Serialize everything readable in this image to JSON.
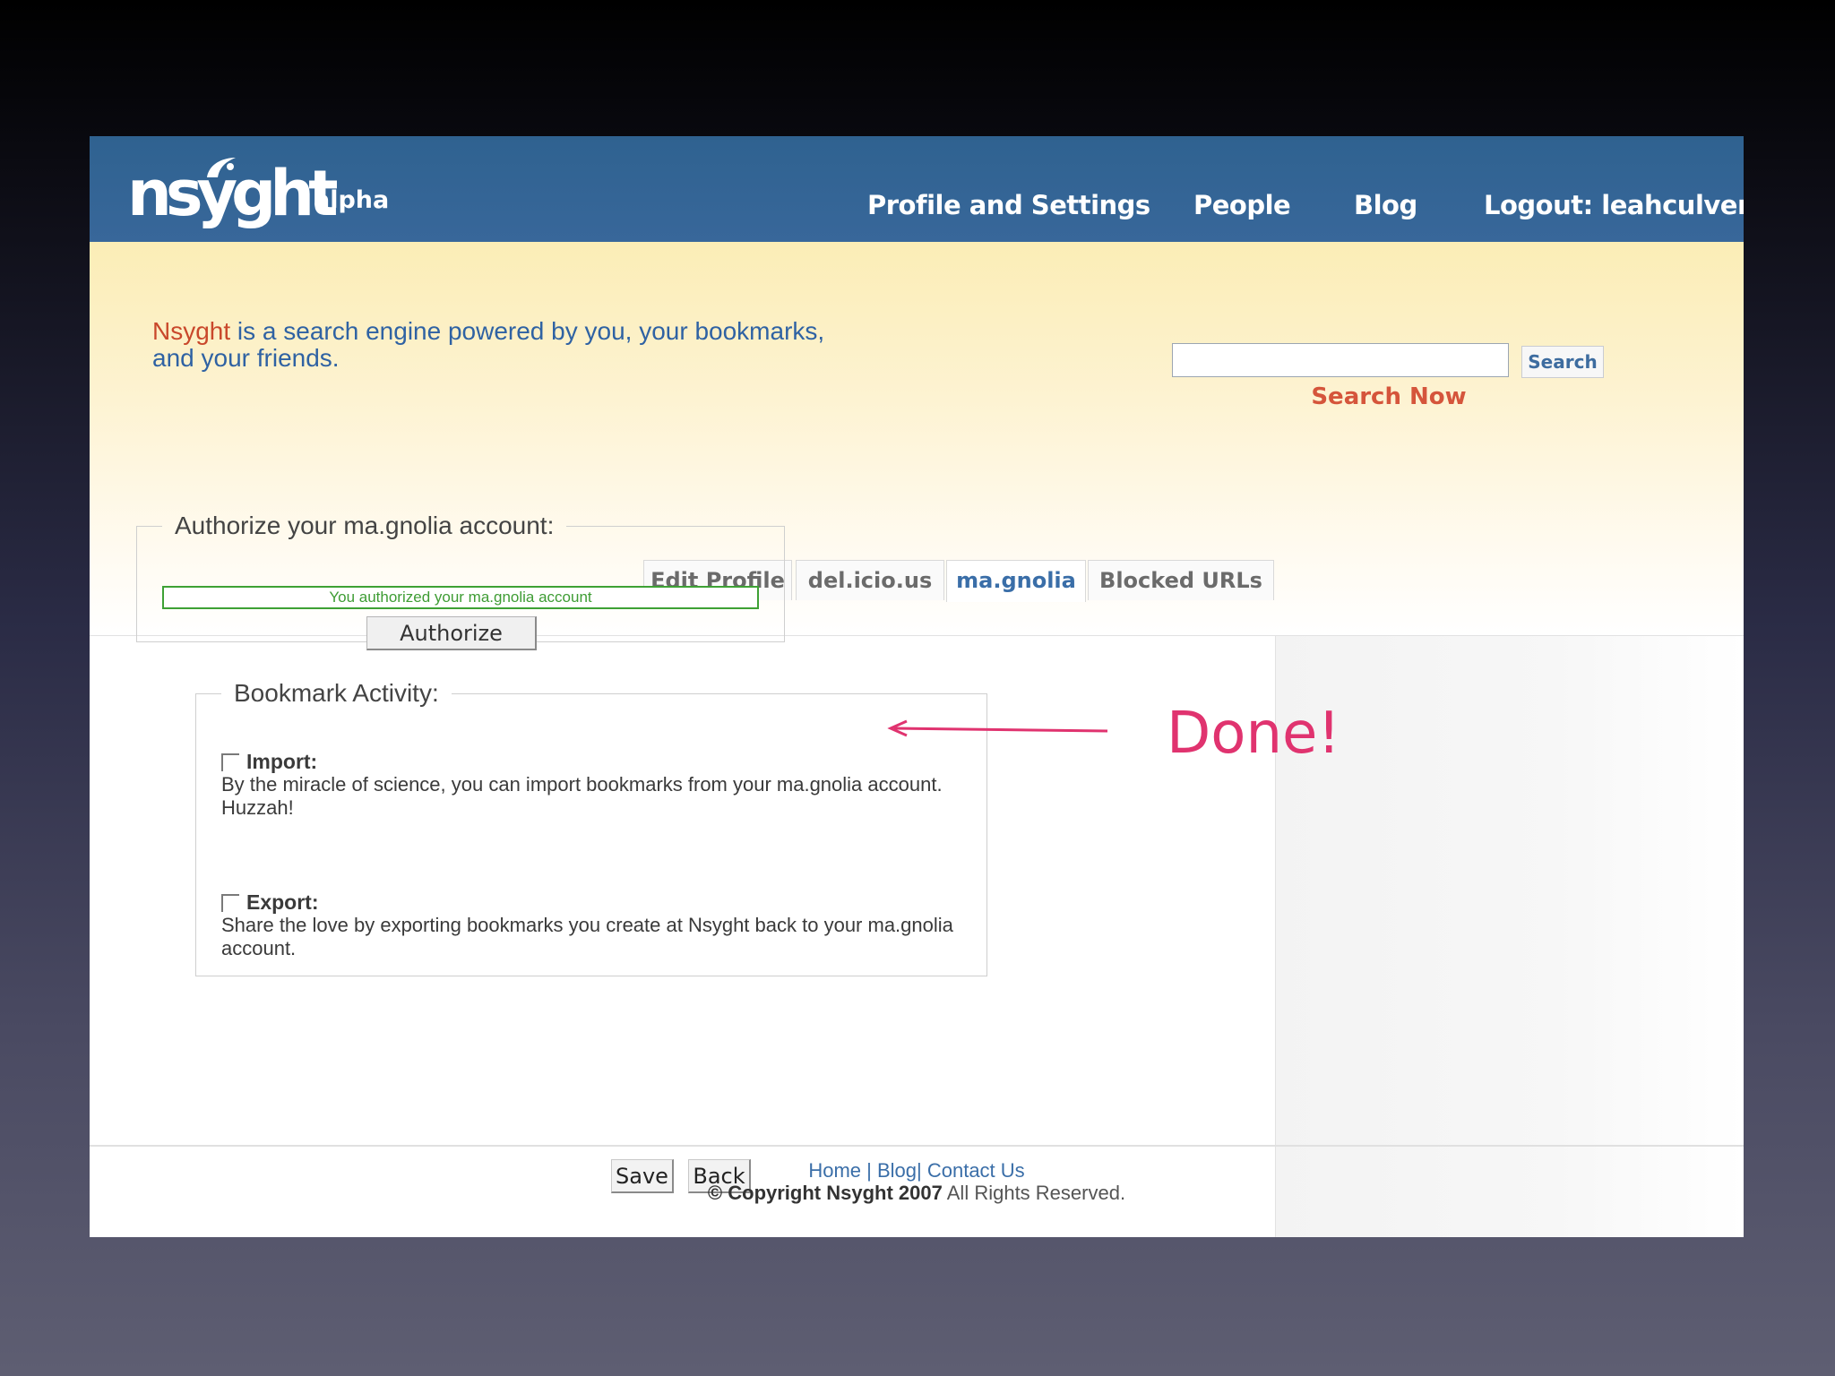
{
  "header": {
    "logo_text": "nsyght",
    "logo_sub": "alpha",
    "nav": [
      "Profile and Settings",
      "People",
      "Blog",
      "Logout: leahculver"
    ]
  },
  "hero": {
    "brand": "Nsyght",
    "tagline_rest": " is a search engine powered by you, your bookmarks,",
    "tagline_line2": "and your friends."
  },
  "search": {
    "value": "",
    "button_label": "Search",
    "search_now": "Search Now"
  },
  "tabs": [
    {
      "label": "Edit Profile",
      "active": false
    },
    {
      "label": "del.icio.us",
      "active": false
    },
    {
      "label": "ma.gnolia",
      "active": true
    },
    {
      "label": "Blocked URLs",
      "active": false
    }
  ],
  "authorize": {
    "legend": "Authorize your ma.gnolia account:",
    "status": "You authorized your ma.gnolia account",
    "button": "Authorize"
  },
  "bookmark": {
    "legend": "Bookmark Activity:",
    "import_label": "Import:",
    "import_desc": "By the miracle of science, you can import bookmarks from your ma.gnolia account. Huzzah!",
    "export_label": "Export:",
    "export_desc": "Share the love by exporting bookmarks you create at Nsyght back to your ma.gnolia account."
  },
  "actions": {
    "save": "Save",
    "back": "Back"
  },
  "footer": {
    "home": "Home",
    "sep1": " | ",
    "blog": "Blog",
    "sep2": "| ",
    "contact": "Contact Us",
    "copyright_bold": "© Copyright Nsyght 2007",
    "copyright_rest": " All Rights Reserved."
  },
  "annotation": {
    "text": "Done!",
    "color": "#e0336f"
  },
  "colors": {
    "nav_blue": "#2f6290",
    "brand_orange": "#c9482b",
    "link_blue": "#3a6ea8",
    "success_green": "#3ea135"
  }
}
